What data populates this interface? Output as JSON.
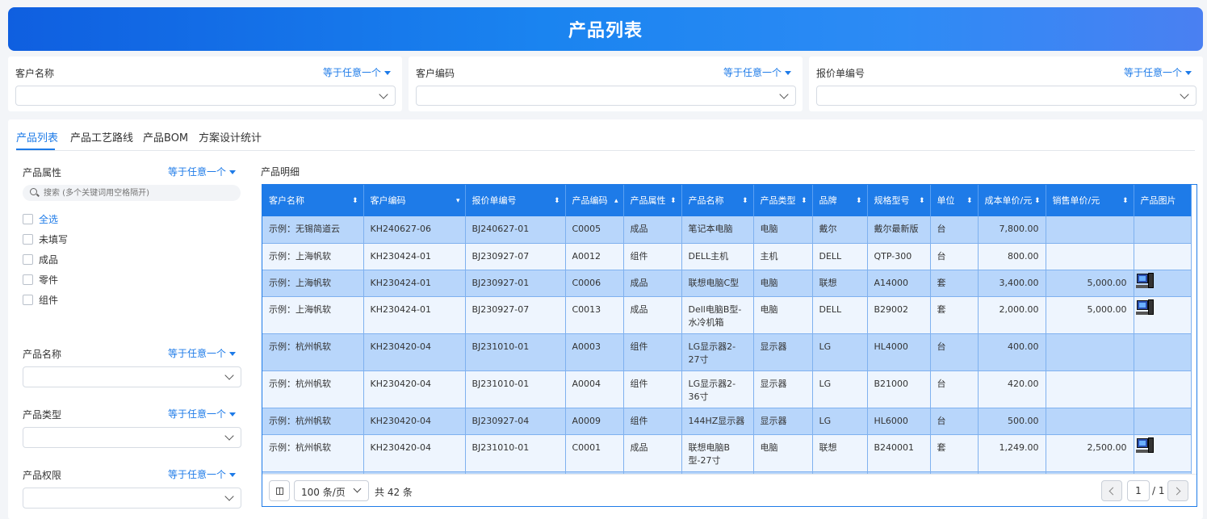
{
  "title": "产品列表",
  "filters": [
    {
      "label": "客户名称",
      "op": "等于任意一个"
    },
    {
      "label": "客户编码",
      "op": "等于任意一个"
    },
    {
      "label": "报价单编号",
      "op": "等于任意一个"
    }
  ],
  "tabs": [
    "产品列表",
    "产品工艺路线",
    "产品BOM",
    "方案设计统计"
  ],
  "side": {
    "attr_label": "产品属性",
    "attr_op": "等于任意一个",
    "search_placeholder": "搜索 (多个关键词用空格隔开)",
    "options": [
      "全选",
      "未填写",
      "成品",
      "零件",
      "组件"
    ],
    "name_label": "产品名称",
    "name_op": "等于任意一个",
    "type_label": "产品类型",
    "type_op": "等于任意一个",
    "perm_label": "产品权限",
    "perm_op": "等于任意一个"
  },
  "detail_title": "产品明细",
  "columns": [
    "客户名称",
    "客户编码",
    "报价单编号",
    "产品编码",
    "产品属性",
    "产品名称",
    "产品类型",
    "品牌",
    "规格型号",
    "单位",
    "成本单价/元",
    "销售单价/元",
    "产品图片"
  ],
  "rows": [
    [
      "示例：无锡简道云",
      "KH240627-06",
      "BJ240627-01",
      "C0005",
      "成品",
      "笔记本电脑",
      "电脑",
      "戴尔",
      "戴尔最新版",
      "台",
      "7,800.00",
      "",
      ""
    ],
    [
      "示例：上海帆软",
      "KH230424-01",
      "BJ230927-07",
      "A0012",
      "组件",
      "DELL主机",
      "主机",
      "DELL",
      "QTP-300",
      "台",
      "800.00",
      "",
      ""
    ],
    [
      "示例：上海帆软",
      "KH230424-01",
      "BJ230927-01",
      "C0006",
      "成品",
      "联想电脑C型",
      "电脑",
      "联想",
      "A14000",
      "套",
      "3,400.00",
      "5,000.00",
      "pc"
    ],
    [
      "示例：上海帆软",
      "KH230424-01",
      "BJ230927-07",
      "C0013",
      "成品",
      "Dell电脑B型-水冷机箱",
      "电脑",
      "DELL",
      "B29002",
      "套",
      "2,000.00",
      "5,000.00",
      "pc"
    ],
    [
      "示例：杭州帆软",
      "KH230420-04",
      "BJ231010-01",
      "A0003",
      "组件",
      "LG显示器2-27寸",
      "显示器",
      "LG",
      "HL4000",
      "台",
      "400.00",
      "",
      ""
    ],
    [
      "示例：杭州帆软",
      "KH230420-04",
      "BJ231010-01",
      "A0004",
      "组件",
      "LG显示器2-36寸",
      "显示器",
      "LG",
      "B21000",
      "台",
      "420.00",
      "",
      ""
    ],
    [
      "示例：杭州帆软",
      "KH230420-04",
      "BJ230927-04",
      "A0009",
      "组件",
      "144HZ显示器",
      "显示器",
      "LG",
      "HL6000",
      "台",
      "500.00",
      "",
      ""
    ],
    [
      "示例：杭州帆软",
      "KH230420-04",
      "BJ231010-01",
      "C0001",
      "成品",
      "联想电脑B型-27寸",
      "电脑",
      "联想",
      "B240001",
      "套",
      "1,249.00",
      "2,500.00",
      "pc"
    ]
  ],
  "pager": {
    "size": "100 条/页",
    "total": "共 42 条",
    "page": "1",
    "pages": "/ 1"
  }
}
